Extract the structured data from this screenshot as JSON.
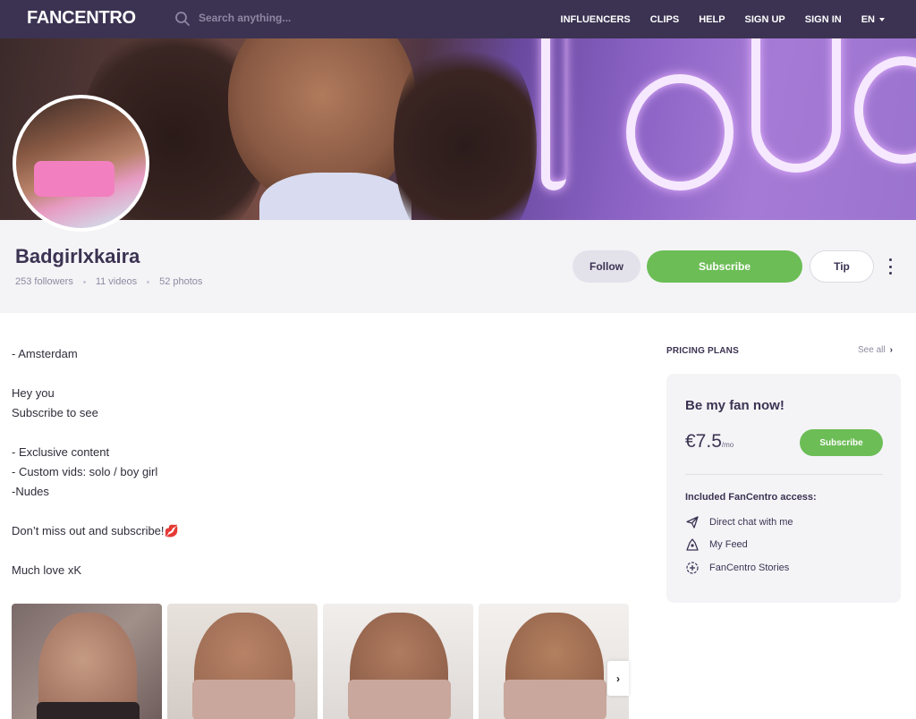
{
  "nav": {
    "logo": "FANCENTRO",
    "search_placeholder": "Search anything...",
    "links": [
      "INFLUENCERS",
      "CLIPS",
      "HELP",
      "SIGN UP",
      "SIGN IN"
    ],
    "language": "EN"
  },
  "profile": {
    "username": "Badgirlxkaira",
    "followers": "253 followers",
    "videos": "11 videos",
    "photos": "52 photos",
    "follow_label": "Follow",
    "subscribe_label": "Subscribe",
    "tip_label": "Tip"
  },
  "bio": {
    "lines": [
      "- Amsterdam",
      "",
      "Hey you",
      "Subscribe to see",
      "",
      "- Exclusive content",
      "- Custom vids: solo / boy girl",
      "-Nudes",
      "",
      "Don’t miss out and subscribe!💋",
      "",
      "Much love xK"
    ]
  },
  "gallery": {
    "next_label": "›"
  },
  "pricing": {
    "title": "PRICING PLANS",
    "see_all": "See all",
    "plan": {
      "heading": "Be my fan now!",
      "price": "€7.5",
      "period": "/mo",
      "subscribe_label": "Subscribe",
      "included_title": "Included FanCentro access:",
      "features": [
        {
          "icon": "paper-plane-icon",
          "label": "Direct chat with me"
        },
        {
          "icon": "feed-icon",
          "label": "My Feed"
        },
        {
          "icon": "stories-plus-icon",
          "label": "FanCentro Stories"
        }
      ]
    }
  },
  "colors": {
    "nav_bg": "#3c3352",
    "accent_green": "#6cbd56",
    "panel_bg": "#f4f4f7"
  }
}
